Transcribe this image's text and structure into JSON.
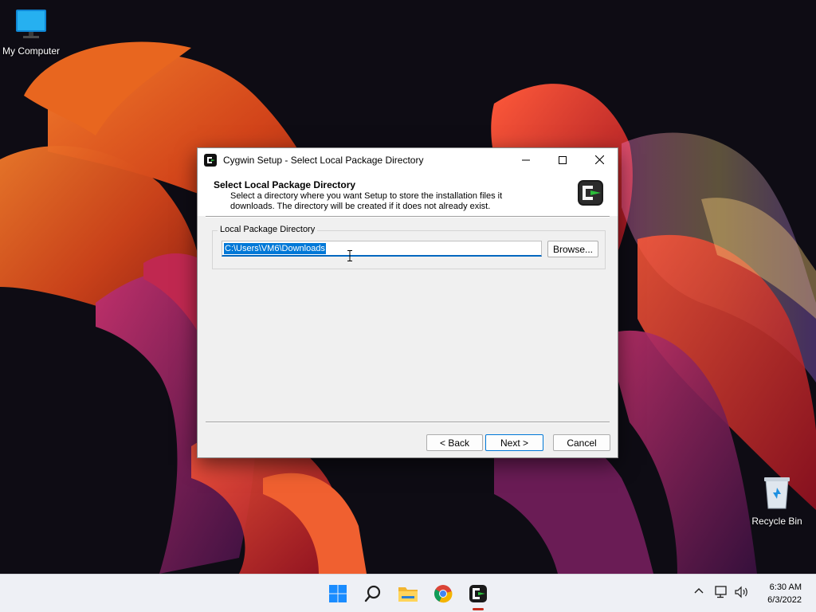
{
  "desktop": {
    "icons": [
      {
        "label": "My Computer"
      },
      {
        "label": "Recycle Bin"
      }
    ]
  },
  "dialog": {
    "window_title": "Cygwin Setup - Select Local Package Directory",
    "header_title": "Select Local Package Directory",
    "header_description": "Select a directory where you want Setup to store the installation files it downloads.  The directory will be created if it does not already exist.",
    "group_label": "Local Package Directory",
    "directory_value": "C:\\Users\\VM6\\Downloads",
    "browse_label": "Browse...",
    "back_label": "< Back",
    "next_label": "Next >",
    "cancel_label": "Cancel"
  },
  "taskbar": {
    "apps": [
      "start-icon",
      "search-icon",
      "file-explorer-icon",
      "chrome-icon",
      "cygwin-icon"
    ],
    "active_app": "cygwin-icon",
    "clock_time": "6:30 AM",
    "clock_date": "6/3/2022"
  },
  "colors": {
    "accent": "#0078d7",
    "active_indicator": "#c42b1c"
  }
}
